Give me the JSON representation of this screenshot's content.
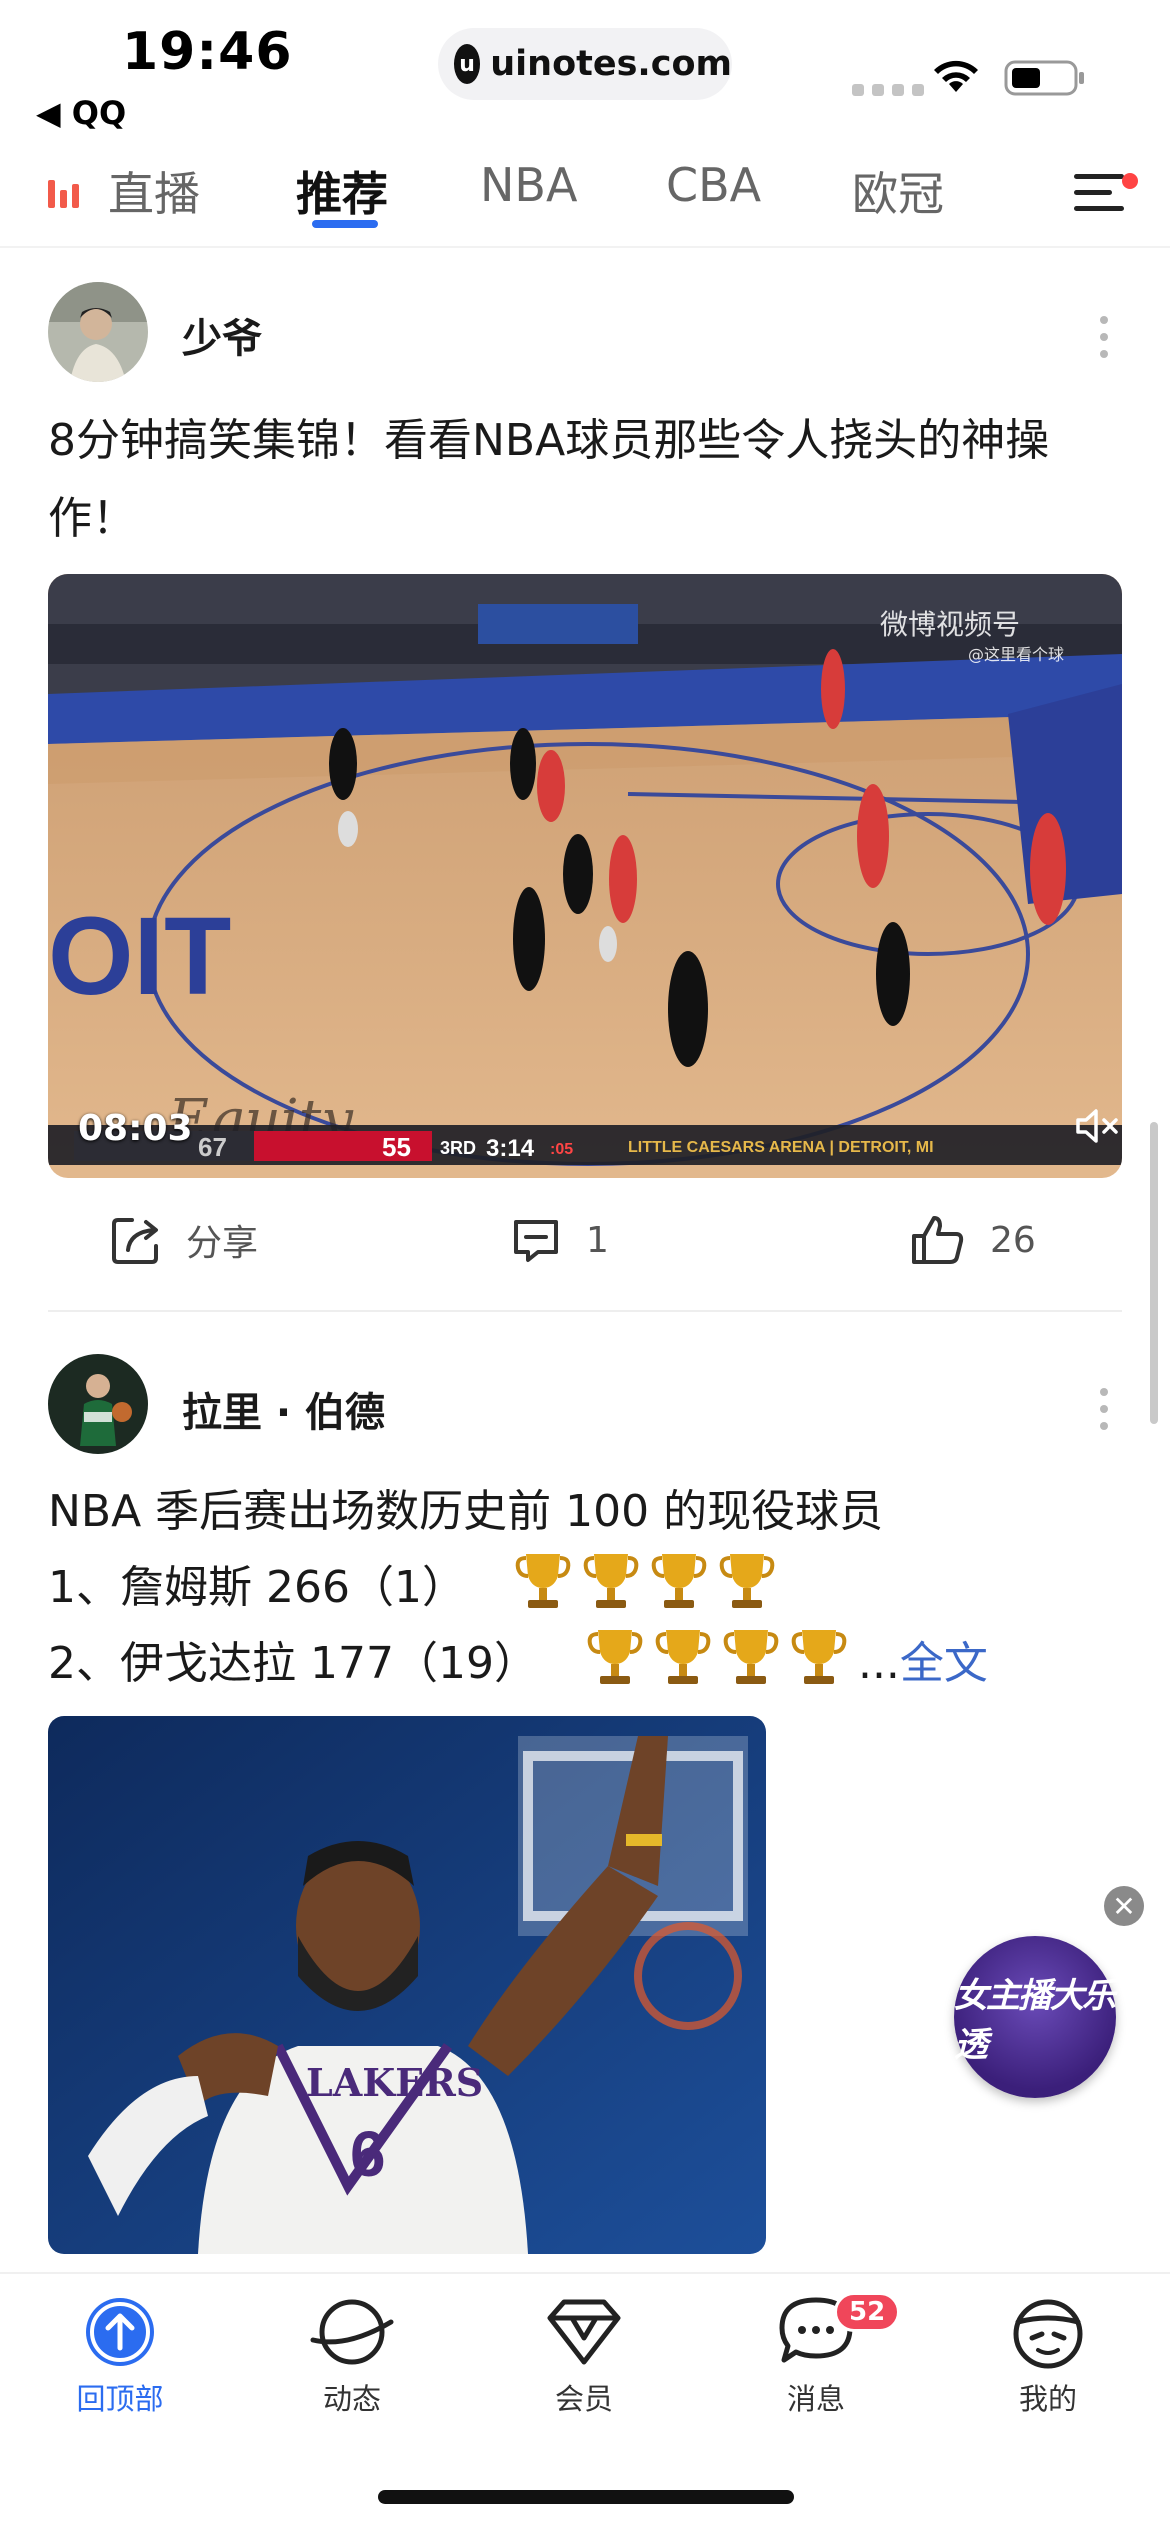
{
  "status_bar": {
    "time": "19:46",
    "back_app": "◀ QQ",
    "url": "uinotes.com"
  },
  "tabs": [
    {
      "label": "直播",
      "active": false
    },
    {
      "label": "推荐",
      "active": true
    },
    {
      "label": "NBA",
      "active": false
    },
    {
      "label": "CBA",
      "active": false
    },
    {
      "label": "欧冠",
      "active": false
    }
  ],
  "post1": {
    "author": "少爷",
    "title": "8分钟搞笑集锦！看看NBA球员那些令人挠头的神操作！",
    "video": {
      "duration": "08:03",
      "watermark": "微博视频号",
      "watermark_sub": "@这里看个球",
      "score_home": "67",
      "score_away": "55",
      "quarter": "3RD",
      "clock": "3:14",
      "shot_clock": ":05",
      "arena": "LITTLE CAESARS ARENA | DETROIT, MI"
    },
    "actions": {
      "share": "分享",
      "comments": "1",
      "likes": "26"
    }
  },
  "post2": {
    "author": "拉里 · 伯德",
    "line1": "NBA 季后赛出场数历史前 100 的现役球员",
    "line2": "1、詹姆斯 266（1）",
    "line3": "2、伊戈达拉 177（19）",
    "ellipsis": "...",
    "more_link": "全文",
    "image": {
      "jersey_text": "LAKERS",
      "jersey_number": "6"
    }
  },
  "float_promo": {
    "title": "女主播大乐透",
    "close": "✕"
  },
  "bottom_nav": [
    {
      "label": "回顶部",
      "icon": "back-to-top-icon",
      "active": true
    },
    {
      "label": "动态",
      "icon": "planet-icon",
      "active": false
    },
    {
      "label": "会员",
      "icon": "diamond-icon",
      "active": false
    },
    {
      "label": "消息",
      "icon": "message-icon",
      "active": false,
      "badge": "52"
    },
    {
      "label": "我的",
      "icon": "profile-icon",
      "active": false
    }
  ],
  "colors": {
    "accent": "#2b6cf0",
    "live": "#f25a4a",
    "badge": "#f0465a",
    "link": "#3b68c8"
  }
}
